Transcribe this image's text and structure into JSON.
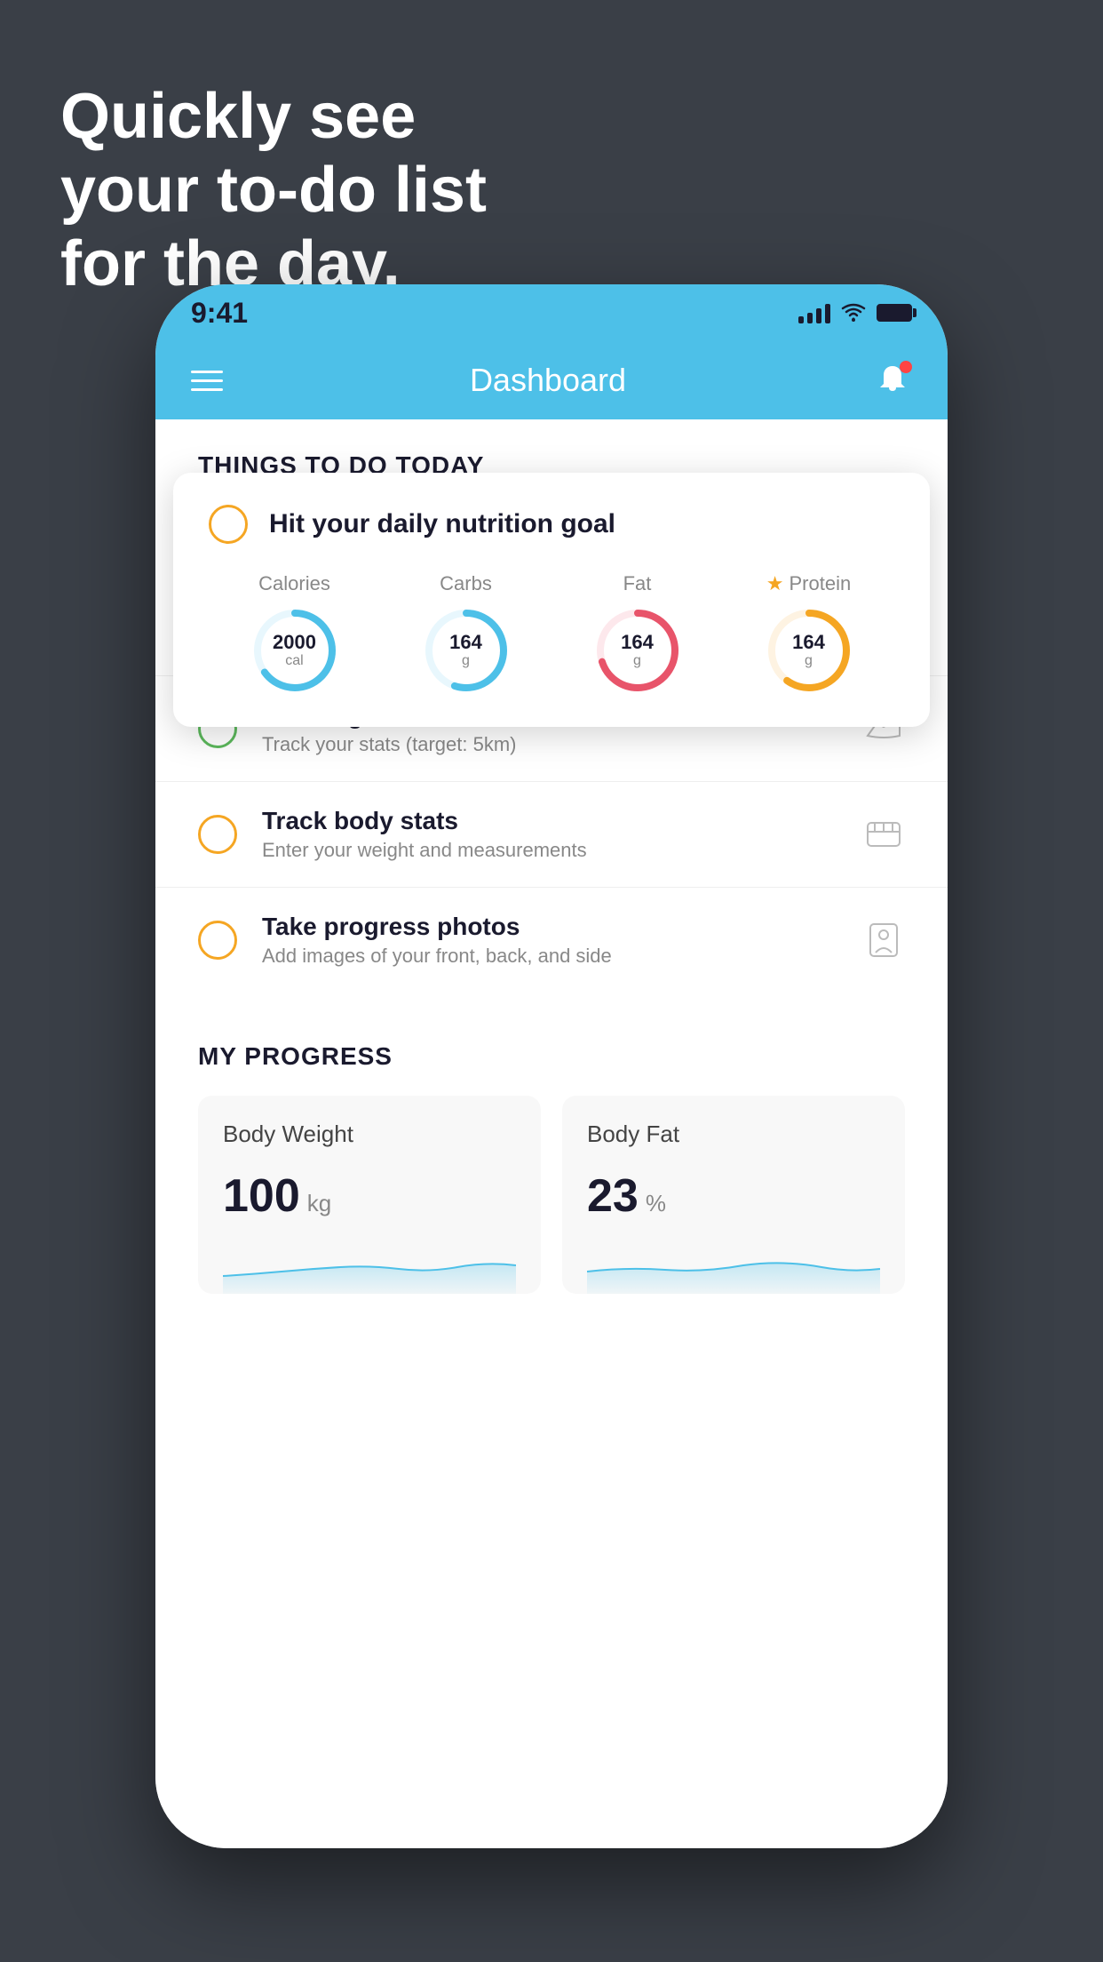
{
  "headline": {
    "line1": "Quickly see",
    "line2": "your to-do list",
    "line3": "for the day."
  },
  "status_bar": {
    "time": "9:41"
  },
  "header": {
    "title": "Dashboard"
  },
  "things_section": {
    "heading": "THINGS TO DO TODAY"
  },
  "nutrition_card": {
    "title": "Hit your daily nutrition goal",
    "stats": [
      {
        "label": "Calories",
        "value": "2000",
        "unit": "cal",
        "color": "#4dc0e8",
        "track_pct": 65
      },
      {
        "label": "Carbs",
        "value": "164",
        "unit": "g",
        "color": "#4dc0e8",
        "track_pct": 55
      },
      {
        "label": "Fat",
        "value": "164",
        "unit": "g",
        "color": "#e8546a",
        "track_pct": 70
      },
      {
        "label": "Protein",
        "value": "164",
        "unit": "g",
        "color": "#f5a623",
        "track_pct": 60,
        "starred": true
      }
    ]
  },
  "todo_items": [
    {
      "name": "Running",
      "sub": "Track your stats (target: 5km)",
      "circle_color": "green",
      "icon": "shoe"
    },
    {
      "name": "Track body stats",
      "sub": "Enter your weight and measurements",
      "circle_color": "yellow",
      "icon": "scale"
    },
    {
      "name": "Take progress photos",
      "sub": "Add images of your front, back, and side",
      "circle_color": "yellow",
      "icon": "person"
    }
  ],
  "progress_section": {
    "heading": "MY PROGRESS",
    "cards": [
      {
        "title": "Body Weight",
        "value": "100",
        "unit": "kg"
      },
      {
        "title": "Body Fat",
        "value": "23",
        "unit": "%"
      }
    ]
  }
}
